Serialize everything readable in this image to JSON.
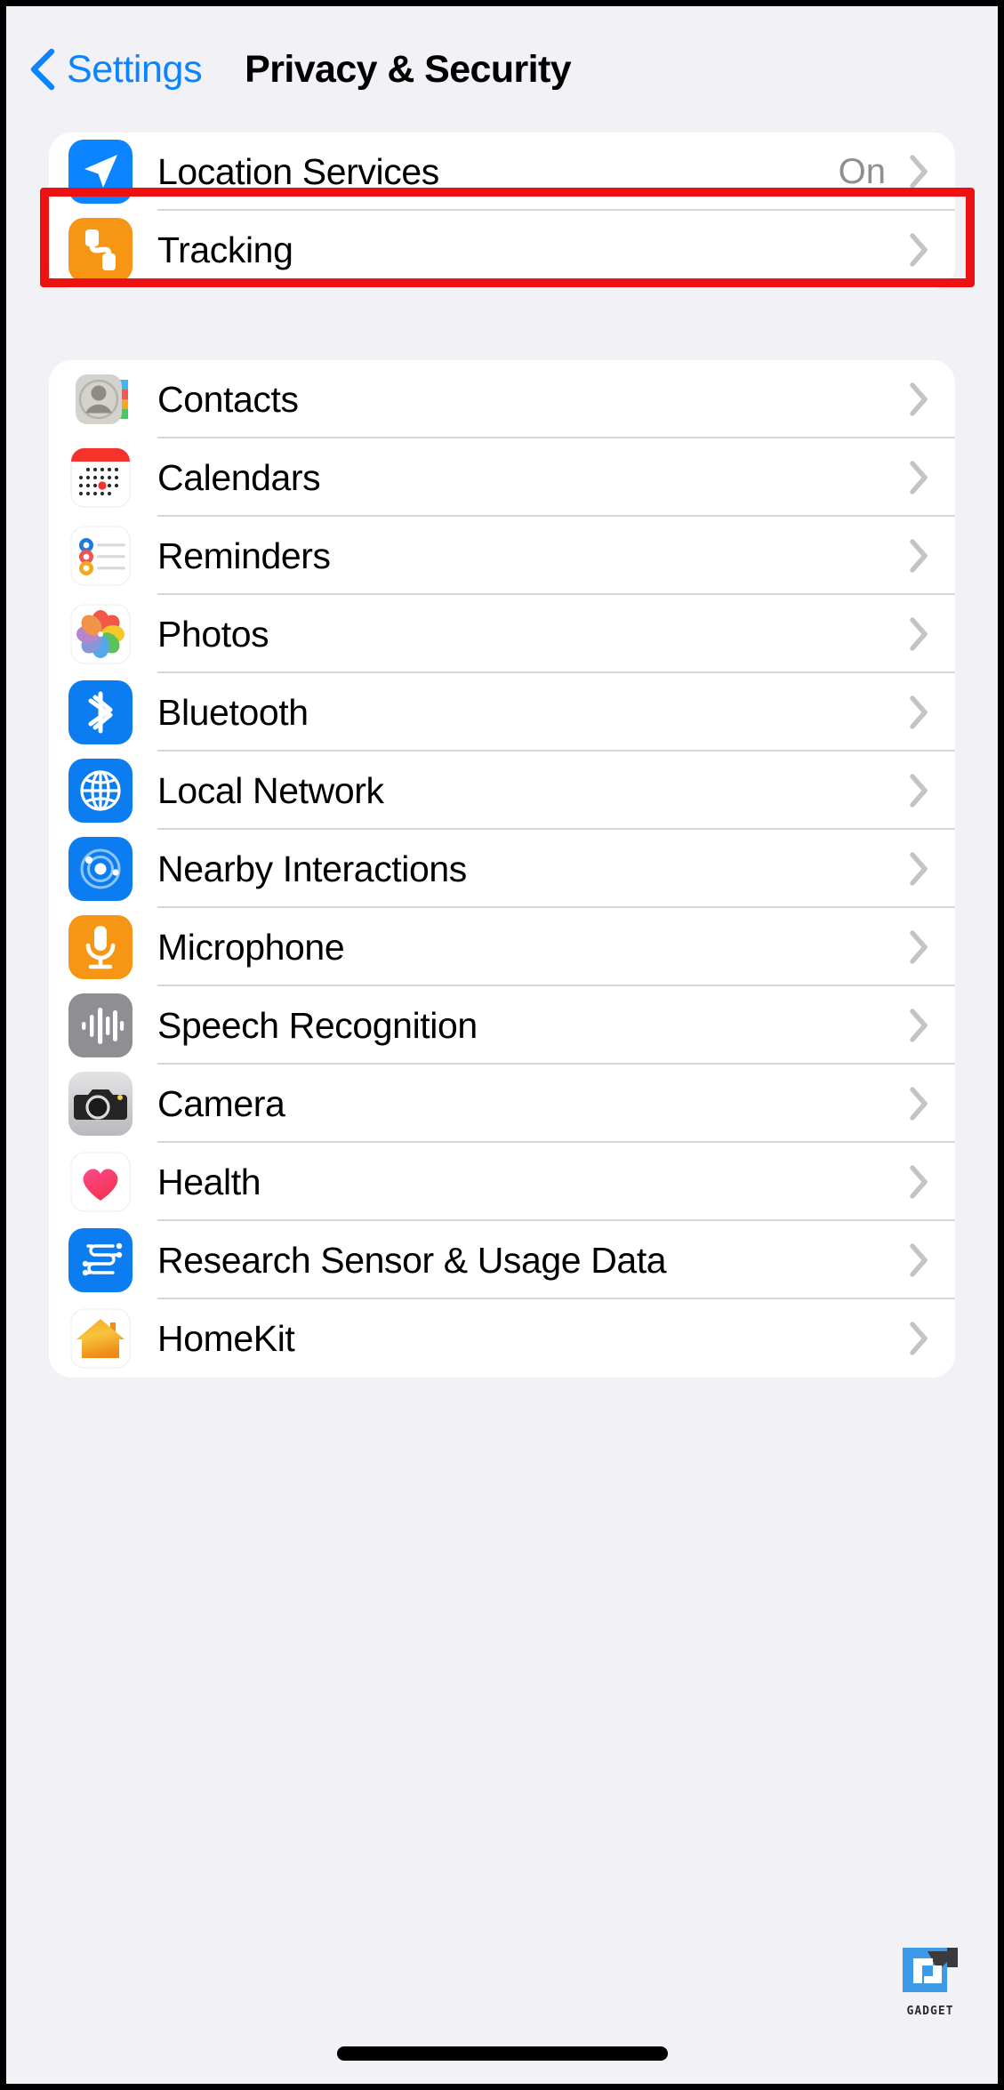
{
  "nav": {
    "back_label": "Settings",
    "back_icon": "chevron-left-icon",
    "title": "Privacy & Security"
  },
  "groups": [
    {
      "id": "privacy-core",
      "rows": [
        {
          "label": "Location Services",
          "value": "On",
          "icon": "location-services-icon",
          "highlighted": true
        },
        {
          "label": "Tracking",
          "value": "",
          "icon": "tracking-icon",
          "highlighted": false
        }
      ]
    },
    {
      "id": "app-permissions",
      "rows": [
        {
          "label": "Contacts",
          "value": "",
          "icon": "contacts-icon"
        },
        {
          "label": "Calendars",
          "value": "",
          "icon": "calendar-icon"
        },
        {
          "label": "Reminders",
          "value": "",
          "icon": "reminders-icon"
        },
        {
          "label": "Photos",
          "value": "",
          "icon": "photos-icon"
        },
        {
          "label": "Bluetooth",
          "value": "",
          "icon": "bluetooth-icon"
        },
        {
          "label": "Local Network",
          "value": "",
          "icon": "local-network-icon"
        },
        {
          "label": "Nearby Interactions",
          "value": "",
          "icon": "nearby-interactions-icon"
        },
        {
          "label": "Microphone",
          "value": "",
          "icon": "microphone-icon"
        },
        {
          "label": "Speech Recognition",
          "value": "",
          "icon": "speech-recognition-icon"
        },
        {
          "label": "Camera",
          "value": "",
          "icon": "camera-icon"
        },
        {
          "label": "Health",
          "value": "",
          "icon": "health-icon"
        },
        {
          "label": "Research Sensor & Usage Data",
          "value": "",
          "icon": "research-sensor-icon"
        },
        {
          "label": "HomeKit",
          "value": "",
          "icon": "homekit-icon"
        }
      ]
    }
  ],
  "watermark": {
    "text": "GADGET"
  },
  "colors": {
    "accent_blue": "#0a84ff",
    "highlight_red": "#ee1111",
    "page_background": "#f1f1f6",
    "card_background": "#ffffff",
    "value_gray": "#8e8e93",
    "chevron_gray": "#c4c4c8",
    "separator": "#d6d6da"
  }
}
